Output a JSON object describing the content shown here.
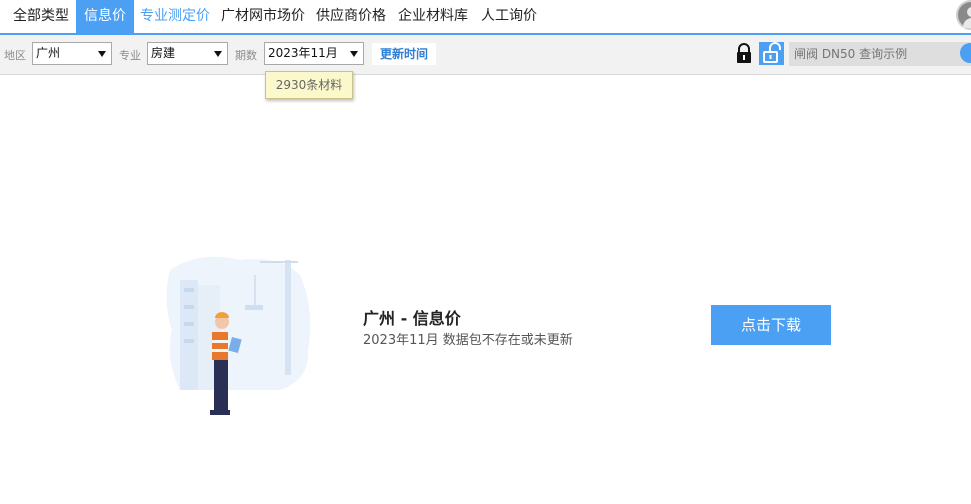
{
  "tabs": [
    {
      "label": "全部类型",
      "state": "normal"
    },
    {
      "label": "信息价",
      "state": "active"
    },
    {
      "label": "专业测定价",
      "state": "highlight"
    },
    {
      "label": "广材网市场价",
      "state": "normal"
    },
    {
      "label": "供应商价格",
      "state": "normal"
    },
    {
      "label": "企业材料库",
      "state": "normal"
    },
    {
      "label": "人工询价",
      "state": "normal"
    }
  ],
  "filters": {
    "region_label": "地区",
    "region_value": "广州",
    "profession_label": "专业",
    "profession_value": "房建",
    "period_label": "期数",
    "period_value": "2023年11月",
    "update_button": "更新时间"
  },
  "search": {
    "placeholder": "闸阀 DN50 查询示例"
  },
  "tooltip": {
    "text": "2930条材料"
  },
  "empty_state": {
    "title": "广州 - 信息价",
    "message": "2023年11月 数据包不存在或未更新",
    "download_button": "点击下载"
  },
  "icons": {
    "lock": "lock-icon",
    "unlock": "unlock-icon",
    "user": "user-avatar-icon"
  },
  "colors": {
    "accent": "#4ba0f4",
    "tooltip_bg": "#fbf9cc"
  }
}
